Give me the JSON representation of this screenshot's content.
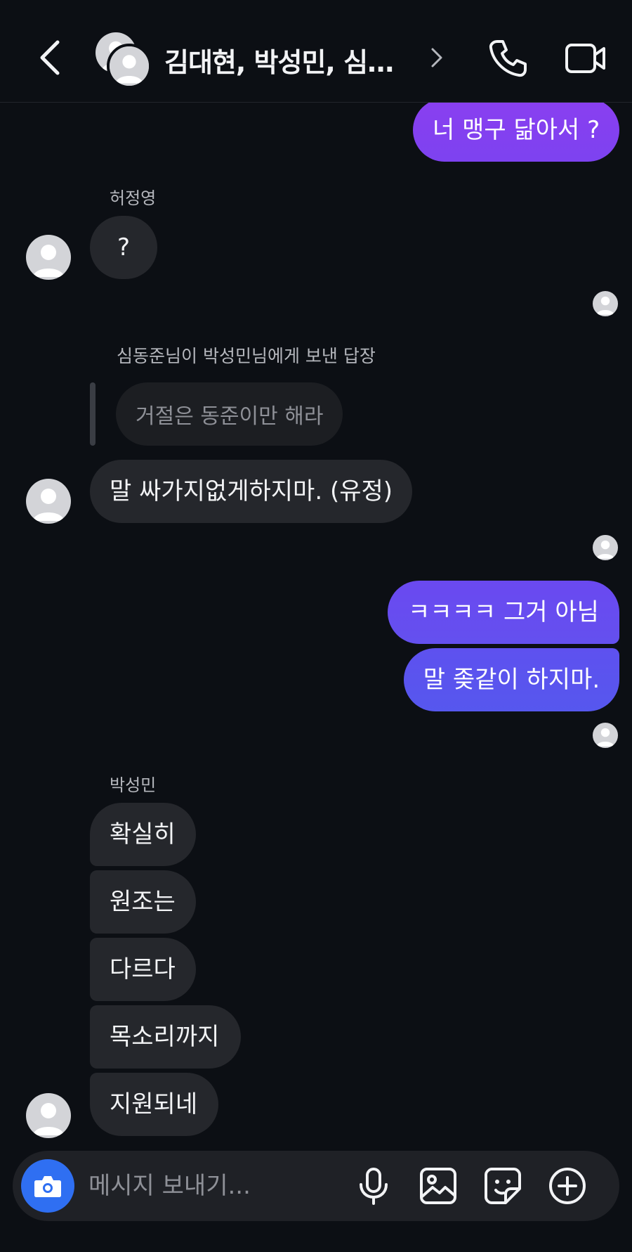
{
  "header": {
    "title": "김대현, 박성민, 심동준..."
  },
  "messages": {
    "m1": "너 맹구 닮아서 ?",
    "sender1": "허정영",
    "m2": "?",
    "reply_caption": "심동준님이 박성민님에게 보낸 답장",
    "reply_quote": "거절은 동준이만 해라",
    "m3": "말 싸가지없게하지마. (유정)",
    "m4": "ㅋㅋㅋㅋ 그거 아님",
    "m5": "말 좆같이 하지마.",
    "sender2": "박성민",
    "m6": "확실히",
    "m7": "원조는",
    "m8": "다르다",
    "m9": "목소리까지",
    "m10": "지원되네"
  },
  "composer": {
    "placeholder": "메시지 보내기..."
  },
  "colors": {
    "bubble_mine_top": "#8a3ff0",
    "bubble_mine_bottom": "#5a55ef",
    "bubble_theirs": "#25272c",
    "background": "#0c0f14",
    "camera_button": "#2f6ff2"
  },
  "icons": [
    "back-icon",
    "group-avatar-icon",
    "chevron-right-icon",
    "phone-icon",
    "video-camera-icon",
    "camera-icon",
    "microphone-icon",
    "image-icon",
    "sticker-icon",
    "plus-circle-icon",
    "avatar-icon",
    "seen-avatar-icon"
  ]
}
